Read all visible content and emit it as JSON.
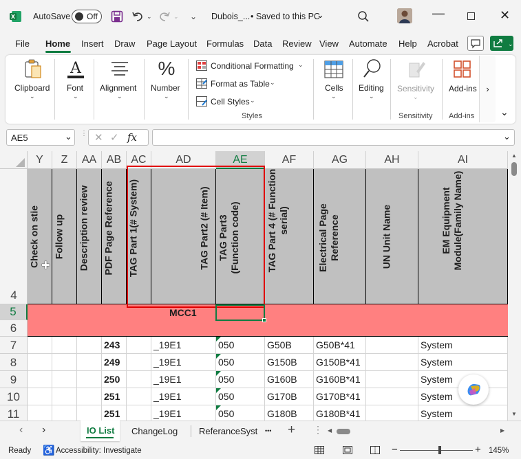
{
  "titlebar": {
    "autosave_label": "AutoSave",
    "autosave_state": "Off",
    "file_name": "Dubois_...",
    "save_status": "• Saved to this PC"
  },
  "menu_tabs": [
    "File",
    "Home",
    "Insert",
    "Draw",
    "Page Layout",
    "Formulas",
    "Data",
    "Review",
    "View",
    "Automate",
    "Help",
    "Acrobat"
  ],
  "ribbon": {
    "clipboard": "Clipboard",
    "font": "Font",
    "alignment": "Alignment",
    "number": "Number",
    "conditional_formatting": "Conditional Formatting",
    "format_as_table": "Format as Table",
    "cell_styles": "Cell Styles",
    "styles_group": "Styles",
    "cells": "Cells",
    "editing": "Editing",
    "sensitivity": "Sensitivity",
    "sensitivity_group": "Sensitivity",
    "addins": "Add-ins",
    "addins_group": "Add-ins"
  },
  "formula_bar": {
    "name_box": "AE5",
    "fx": "fx",
    "value": ""
  },
  "columns": [
    "Y",
    "Z",
    "AA",
    "AB",
    "AC",
    "AD",
    "AE",
    "AF",
    "AG",
    "AH",
    "AI"
  ],
  "rows": [
    "4",
    "5",
    "6",
    "7",
    "8",
    "9",
    "10",
    "11"
  ],
  "headers": {
    "Y": "Check on stie",
    "Z": "Follow up",
    "AA": "Description review",
    "AB": "PDF Page Reference",
    "AC": "TAG Part 1(# System)",
    "AD": "TAG Part2 (# Item)",
    "AE": "TAG Part3 (Function code)",
    "AF": "TAG Part 4 (# Function serial)",
    "AG": "Electrical Page Reference",
    "AH": "UN Unit Name",
    "AI": "EM Equipment Module(Family Name)"
  },
  "section_label": "MCC1",
  "data_rows": [
    {
      "ab": "243",
      "ad": "_19E1",
      "ae": "050",
      "af": "G50B",
      "ag": "G50B*41",
      "ai": "System"
    },
    {
      "ab": "249",
      "ad": "_19E1",
      "ae": "050",
      "af": "G150B",
      "ag": "G150B*41",
      "ai": "System"
    },
    {
      "ab": "250",
      "ad": "_19E1",
      "ae": "050",
      "af": "G160B",
      "ag": "G160B*41",
      "ai": "System"
    },
    {
      "ab": "251",
      "ad": "_19E1",
      "ae": "050",
      "af": "G170B",
      "ag": "G170B*41",
      "ai": "System"
    },
    {
      "ab": "251",
      "ad": "_19E1",
      "ae": "050",
      "af": "G180B",
      "ag": "G180B*41",
      "ai": "System"
    }
  ],
  "sheet_tabs": [
    "IO List",
    "ChangeLog",
    "ReferanceSyst"
  ],
  "sheet_more": "•••",
  "status": {
    "ready": "Ready",
    "accessibility": "Accessibility: Investigate",
    "zoom": "145%"
  },
  "colors": {
    "excel_green": "#107c41",
    "pink_band": "#ff8080",
    "header_gray": "#c0c0c0",
    "red_box": "#e00000"
  }
}
